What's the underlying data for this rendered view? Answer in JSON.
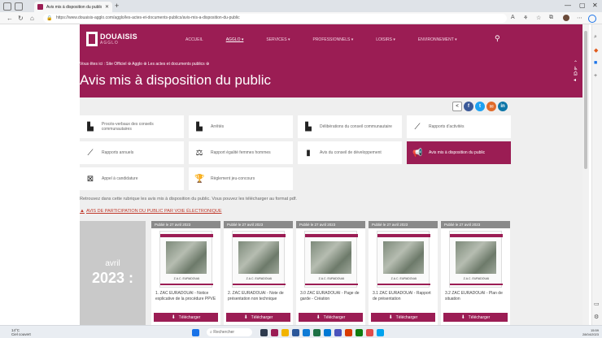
{
  "browser": {
    "tab_title": "Avis mis à disposition du public",
    "url": "https://www.douaisis-agglo.com/agglo/les-actes-et-documents-publics/avis-mis-a-disposition-du-public"
  },
  "site": {
    "logo_name": "DOUAISIS",
    "logo_sub": "AGGLO",
    "menu": [
      {
        "label": "ACCUEIL"
      },
      {
        "label": "AGGLO ▾"
      },
      {
        "label": "SERVICES ▾"
      },
      {
        "label": "PROFESSIONNELS ▾"
      },
      {
        "label": "LOISIRS ▾"
      },
      {
        "label": "ENVIRONNEMENT ▾"
      }
    ],
    "breadcrumb": "Vous êtes ici : Site Officiel ⊕ Agglo ⊕ Les actes et documents publics ⊕",
    "page_title": "Avis mis à disposition du public"
  },
  "share": [
    {
      "label": "<",
      "color": "#ffffff"
    },
    {
      "label": "f",
      "color": "#3b5998"
    },
    {
      "label": "t",
      "color": "#1da1f2"
    },
    {
      "label": "✉",
      "color": "#e06b2b"
    },
    {
      "label": "in",
      "color": "#0e76a8"
    }
  ],
  "categories": [
    {
      "label": "Procès-verbaux des conseils communautaires",
      "icon": "pdf-icon"
    },
    {
      "label": "Arrêtés",
      "icon": "pdf-icon"
    },
    {
      "label": "Délibérations du conseil communautaire",
      "icon": "pdf-icon"
    },
    {
      "label": "Rapports d'activités",
      "icon": "chart-icon"
    },
    {
      "label": "Rapports annuels",
      "icon": "chart-icon"
    },
    {
      "label": "Rapport égalité femmes hommes",
      "icon": "balance-icon"
    },
    {
      "label": "Avis du conseil de développement",
      "icon": "bars-icon"
    },
    {
      "label": "Avis mis à disposition du public",
      "icon": "megaphone-icon"
    },
    {
      "label": "Appel à candidature",
      "icon": "box-icon"
    },
    {
      "label": "Règlement jeu-concours",
      "icon": "trophy-icon"
    }
  ],
  "intro": "Retrouvez dans cette rubrique les avis mis à disposition du public. Vous pouvez les télécharger au format pdf.",
  "participation_link": "AVIS DE PARTICIPATION DU PUBLIC PAR VOIE ÉLECTRONIQUE",
  "period": {
    "month": "avril",
    "year": "2023 :"
  },
  "documents": [
    {
      "date": "Publié le 27 avril 2023",
      "name": "1. ZAC EURADOUAI - Notice explicative de la procédure PPVE",
      "button": "Télécharger"
    },
    {
      "date": "Publié le 27 avril 2023",
      "name": "2. ZAC EURADOUAI - Note de présentation non technique",
      "button": "Télécharger"
    },
    {
      "date": "Publié le 27 avril 2023",
      "name": "3.0 ZAC EURADOUAI - Page de garde - Création",
      "button": "Télécharger"
    },
    {
      "date": "Publié le 27 avril 2023",
      "name": "3.1 ZAC EURADOUAI - Rapport de présentation",
      "button": "Télécharger"
    },
    {
      "date": "Publié le 27 avril 2023",
      "name": "3.2 ZAC EURADOUAI - Plan de situation",
      "button": "Télécharger"
    }
  ],
  "cover_label": "Z.A.C. EURADOUAI",
  "taskbar": {
    "weather_temp": "14°C",
    "weather_desc": "Ciel couvert",
    "search": "Rechercher",
    "time": "15:59",
    "date": "28/04/2023"
  }
}
